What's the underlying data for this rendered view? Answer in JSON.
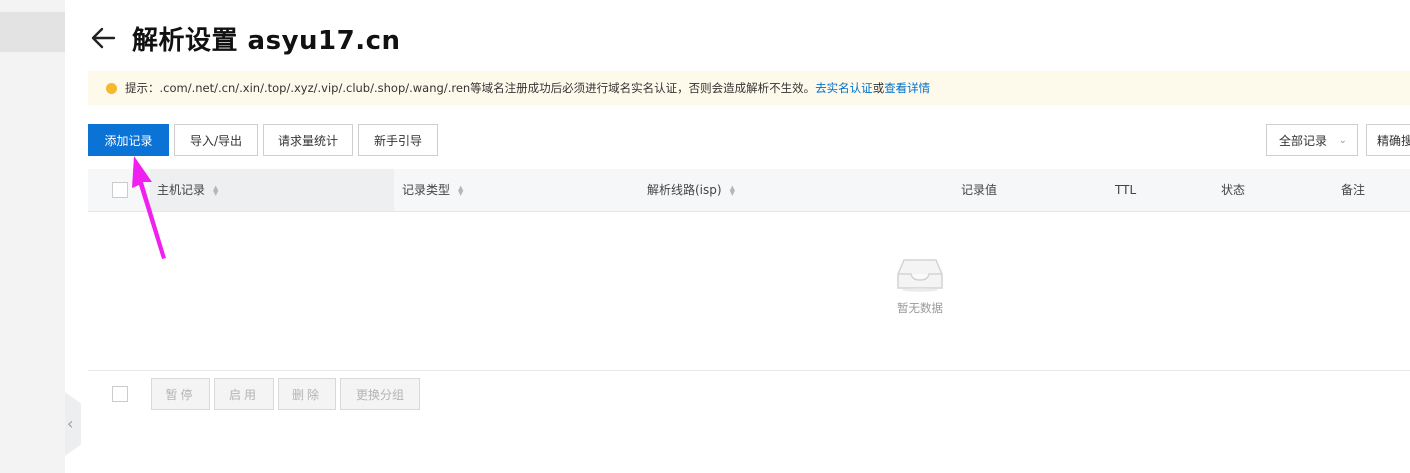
{
  "page": {
    "title": "解析设置 asyu17.cn"
  },
  "notice": {
    "text": "提示：.com/.net/.cn/.xin/.top/.xyz/.vip/.club/.shop/.wang/.ren等域名注册成功后必须进行域名实名认证，否则会造成解析不生效。",
    "link1": "去实名认证",
    "separator": "或",
    "link2": "查看详情"
  },
  "toolbar": {
    "add_record": "添加记录",
    "import_export": "导入/导出",
    "request_stats": "请求量统计",
    "beginner_guide": "新手引导",
    "filter_select": "全部记录",
    "precise_search": "精确搜"
  },
  "table": {
    "columns": {
      "host": "主机记录",
      "type": "记录类型",
      "line": "解析线路(isp)",
      "value": "记录值",
      "ttl": "TTL",
      "status": "状态",
      "remark": "备注"
    },
    "empty_text": "暂无数据"
  },
  "batch": {
    "pause": "暂停",
    "enable": "启用",
    "delete": "删除",
    "change_group": "更换分组"
  },
  "colors": {
    "primary": "#0b72d6",
    "notice_bg": "#fefaeb",
    "notice_dot": "#f5b82e",
    "link": "#0070cc",
    "annotation_arrow": "#f020f0"
  }
}
